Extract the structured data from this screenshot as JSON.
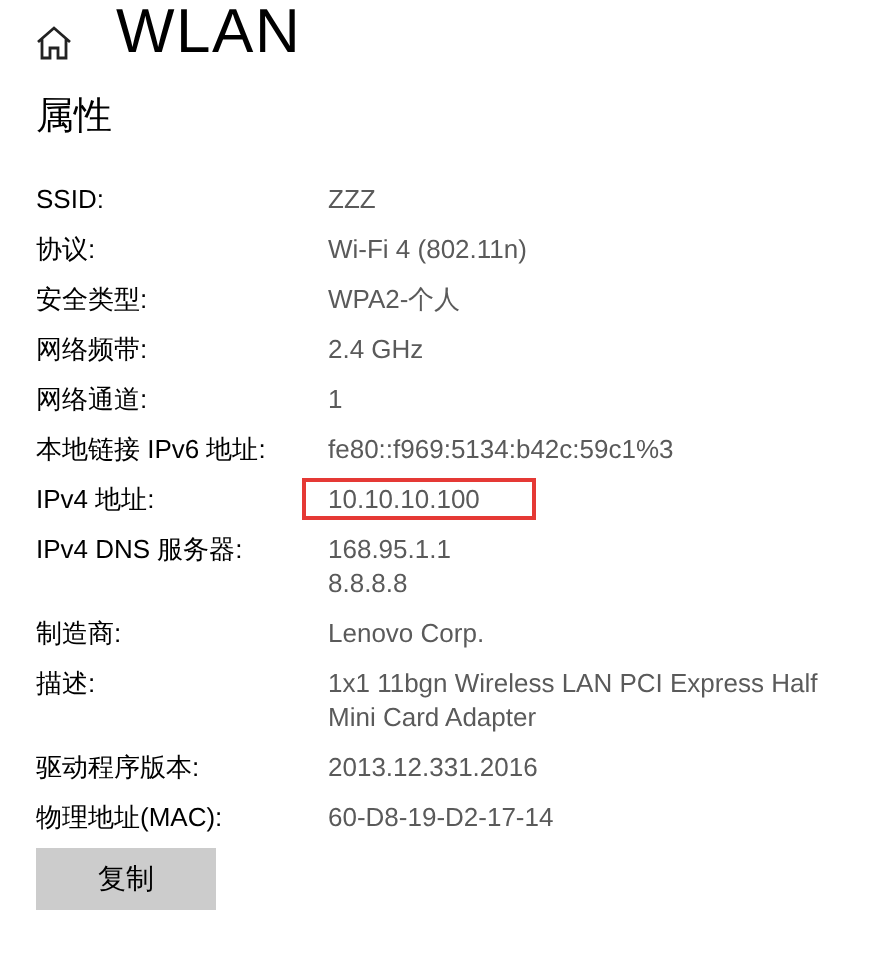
{
  "header": {
    "title": "WLAN"
  },
  "section": {
    "title": "属性"
  },
  "properties": [
    {
      "label": "SSID:",
      "values": [
        "ZZZ"
      ],
      "highlighted": false
    },
    {
      "label": "协议:",
      "values": [
        "Wi-Fi 4 (802.11n)"
      ],
      "highlighted": false
    },
    {
      "label": "安全类型:",
      "values": [
        "WPA2-个人"
      ],
      "highlighted": false
    },
    {
      "label": "网络频带:",
      "values": [
        "2.4 GHz"
      ],
      "highlighted": false
    },
    {
      "label": "网络通道:",
      "values": [
        "1"
      ],
      "highlighted": false
    },
    {
      "label": "本地链接 IPv6 地址:",
      "values": [
        "fe80::f969:5134:b42c:59c1%3"
      ],
      "highlighted": false
    },
    {
      "label": "IPv4 地址:",
      "values": [
        "10.10.10.100"
      ],
      "highlighted": true
    },
    {
      "label": "IPv4 DNS 服务器:",
      "values": [
        "168.95.1.1",
        "8.8.8.8"
      ],
      "highlighted": false
    },
    {
      "label": "制造商:",
      "values": [
        "Lenovo Corp."
      ],
      "highlighted": false
    },
    {
      "label": "描述:",
      "values": [
        "1x1 11bgn Wireless LAN PCI Express Half Mini Card Adapter"
      ],
      "highlighted": false
    },
    {
      "label": "驱动程序版本:",
      "values": [
        "2013.12.331.2016"
      ],
      "highlighted": false
    },
    {
      "label": "物理地址(MAC):",
      "values": [
        "60-D8-19-D2-17-14"
      ],
      "highlighted": false
    }
  ],
  "copy_button": {
    "label": "复制"
  }
}
